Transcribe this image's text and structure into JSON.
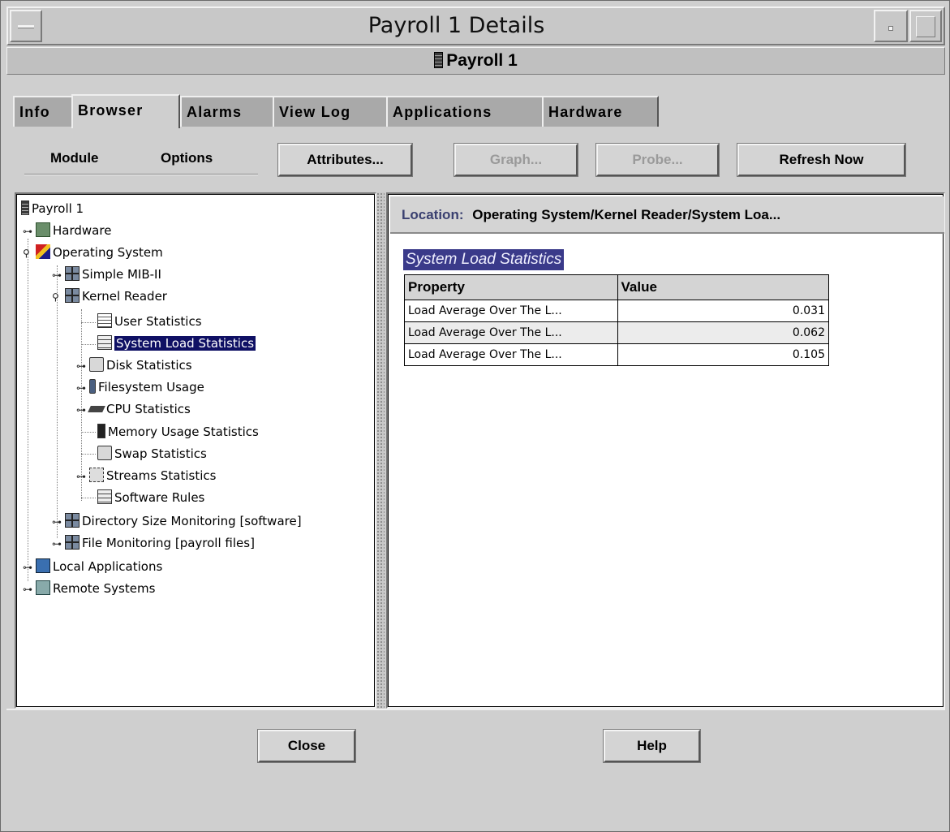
{
  "window": {
    "title": "Payroll 1 Details",
    "header": "Payroll 1"
  },
  "tabs": [
    {
      "label": "Info"
    },
    {
      "label": "Browser"
    },
    {
      "label": "Alarms"
    },
    {
      "label": "View Log"
    },
    {
      "label": "Applications"
    },
    {
      "label": "Hardware"
    }
  ],
  "active_tab": "Browser",
  "toolbar": {
    "module_label": "Module",
    "options_label": "Options",
    "attributes_label": "Attributes...",
    "graph_label": "Graph...",
    "probe_label": "Probe...",
    "refresh_label": "Refresh Now"
  },
  "tree": [
    {
      "label": "Payroll 1",
      "icon": "server-icon"
    },
    {
      "label": "Hardware",
      "icon": "hardware-icon"
    },
    {
      "label": "Operating System",
      "icon": "os-icon"
    },
    {
      "label": "Simple MIB-II",
      "icon": "module-icon"
    },
    {
      "label": "Kernel Reader",
      "icon": "module-icon"
    },
    {
      "label": "User Statistics",
      "icon": "document-icon"
    },
    {
      "label": "System Load Statistics",
      "icon": "chart-icon",
      "selected": true
    },
    {
      "label": "Disk Statistics",
      "icon": "disk-icon"
    },
    {
      "label": "Filesystem Usage",
      "icon": "filesystem-icon"
    },
    {
      "label": "CPU Statistics",
      "icon": "cpu-icon"
    },
    {
      "label": "Memory Usage Statistics",
      "icon": "memory-icon"
    },
    {
      "label": "Swap Statistics",
      "icon": "disk-icon"
    },
    {
      "label": "Streams Statistics",
      "icon": "streams-icon"
    },
    {
      "label": "Software Rules",
      "icon": "chart-icon"
    },
    {
      "label": "Directory Size Monitoring [software]",
      "icon": "module-icon"
    },
    {
      "label": "File Monitoring [payroll files]",
      "icon": "module-icon"
    },
    {
      "label": "Local Applications",
      "icon": "application-icon"
    },
    {
      "label": "Remote Systems",
      "icon": "remote-icon"
    }
  ],
  "location": {
    "label": "Location:",
    "path": "Operating System/Kernel Reader/System Loa..."
  },
  "section_title": "System Load Statistics",
  "table": {
    "headers": [
      "Property",
      "Value"
    ],
    "rows": [
      {
        "property": "Load Average Over The L...",
        "value": "0.031"
      },
      {
        "property": "Load Average Over The L...",
        "value": "0.062"
      },
      {
        "property": "Load Average Over The L...",
        "value": "0.105"
      }
    ]
  },
  "footer": {
    "close_label": "Close",
    "help_label": "Help"
  }
}
